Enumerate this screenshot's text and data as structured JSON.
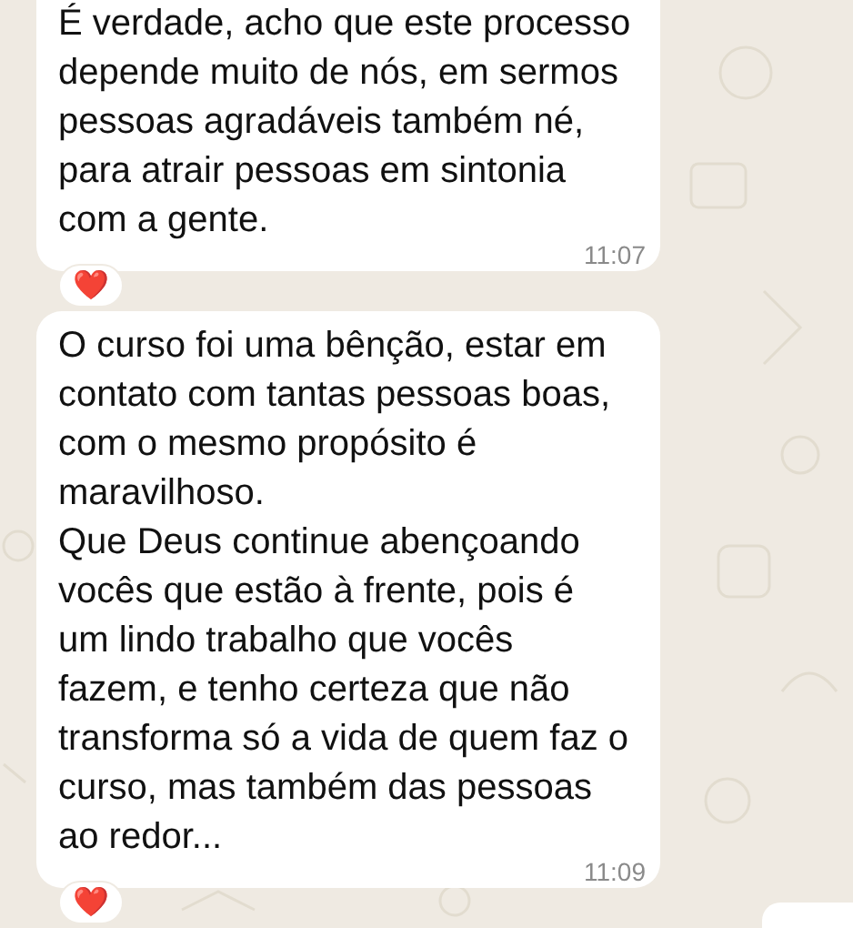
{
  "messages": [
    {
      "text": "É verdade, acho que este processo depende muito de nós, em sermos pessoas agradáveis também né, para atrair pessoas em sintonia com a gente.",
      "time": "11:07",
      "reaction": "❤️"
    },
    {
      "text": "O curso foi uma bênção, estar em contato com tantas pessoas boas, com o mesmo propósito é maravilhoso.\nQue Deus continue abençoando vocês que estão à frente, pois é um lindo trabalho que vocês fazem, e tenho certeza que não transforma só a vida de quem faz o curso, mas também das pessoas ao redor...",
      "time": "11:09",
      "reaction": "❤️"
    }
  ]
}
